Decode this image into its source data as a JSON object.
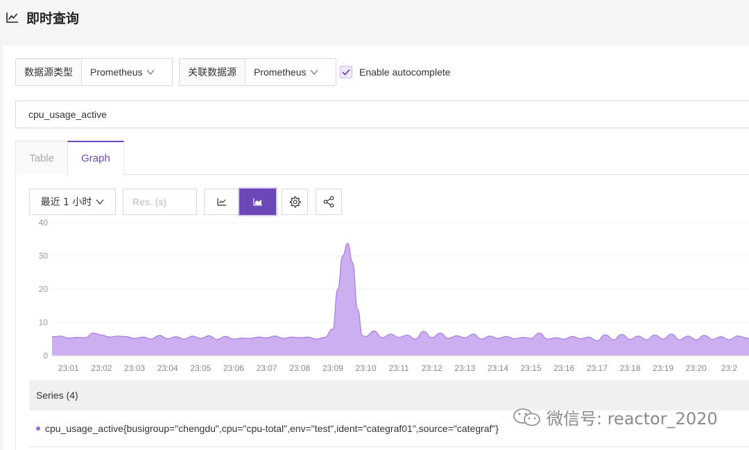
{
  "header": {
    "title": "即时查询",
    "icon": "line-chart-icon"
  },
  "toolbar": {
    "datasource_type_label": "数据源类型",
    "datasource_type_value": "Prometheus",
    "linked_datasource_label": "关联数据源",
    "linked_datasource_value": "Prometheus",
    "autocomplete_label": "Enable autocomplete",
    "autocomplete_checked": true
  },
  "query": {
    "value": "cpu_usage_active"
  },
  "tabs": [
    {
      "label": "Table",
      "active": false
    },
    {
      "label": "Graph",
      "active": true
    }
  ],
  "graph_controls": {
    "time_range": "最近 1 小时",
    "resolution_placeholder": "Res. (s)",
    "line_icon": "line-chart-icon",
    "area_icon": "area-chart-icon",
    "settings_icon": "gear-icon",
    "share_icon": "share-icon"
  },
  "chart_data": {
    "type": "area",
    "x": [
      "23:01",
      "23:02",
      "23:03",
      "23:04",
      "23:05",
      "23:06",
      "23:07",
      "23:08",
      "23:09",
      "23:10",
      "23:11",
      "23:12",
      "23:13",
      "23:14",
      "23:15",
      "23:16",
      "23:17",
      "23:18",
      "23:19",
      "23:20",
      "23:2"
    ],
    "ylim": [
      0,
      40
    ],
    "yticks": [
      0,
      10,
      20,
      30,
      40
    ],
    "x_start_minutes": 0.5,
    "x_end_minutes": 21.6,
    "series": [
      {
        "color": "#c7a6f0",
        "stroke": "#a47be0",
        "points": [
          [
            0.5,
            5.7
          ],
          [
            0.75,
            5.9
          ],
          [
            1.0,
            5.3
          ],
          [
            1.25,
            5.5
          ],
          [
            1.5,
            5.4
          ],
          [
            1.75,
            6.8
          ],
          [
            2.0,
            6.2
          ],
          [
            2.25,
            5.6
          ],
          [
            2.5,
            5.9
          ],
          [
            2.75,
            5.7
          ],
          [
            3.0,
            5.2
          ],
          [
            3.25,
            5.6
          ],
          [
            3.5,
            5.0
          ],
          [
            3.75,
            6.1
          ],
          [
            4.0,
            5.1
          ],
          [
            4.25,
            5.7
          ],
          [
            4.5,
            5.0
          ],
          [
            4.75,
            5.9
          ],
          [
            5.0,
            5.2
          ],
          [
            5.25,
            6.0
          ],
          [
            5.5,
            4.9
          ],
          [
            5.75,
            5.8
          ],
          [
            6.0,
            5.0
          ],
          [
            6.25,
            5.3
          ],
          [
            6.5,
            5.2
          ],
          [
            6.75,
            5.6
          ],
          [
            7.0,
            5.4
          ],
          [
            7.25,
            5.9
          ],
          [
            7.5,
            5.2
          ],
          [
            7.75,
            5.6
          ],
          [
            8.0,
            5.4
          ],
          [
            8.25,
            5.6
          ],
          [
            8.5,
            5.0
          ],
          [
            8.75,
            5.5
          ],
          [
            9.0,
            8.0
          ],
          [
            9.15,
            20.0
          ],
          [
            9.3,
            30.0
          ],
          [
            9.45,
            33.8
          ],
          [
            9.6,
            28.0
          ],
          [
            9.75,
            14.0
          ],
          [
            9.9,
            6.0
          ],
          [
            10.0,
            5.8
          ],
          [
            10.25,
            7.4
          ],
          [
            10.5,
            5.4
          ],
          [
            10.75,
            6.5
          ],
          [
            11.0,
            5.5
          ],
          [
            11.25,
            6.2
          ],
          [
            11.5,
            5.0
          ],
          [
            11.75,
            7.3
          ],
          [
            12.0,
            5.4
          ],
          [
            12.25,
            6.8
          ],
          [
            12.5,
            5.2
          ],
          [
            12.75,
            6.0
          ],
          [
            13.0,
            5.4
          ],
          [
            13.25,
            6.5
          ],
          [
            13.5,
            5.0
          ],
          [
            13.75,
            5.9
          ],
          [
            14.0,
            5.2
          ],
          [
            14.25,
            5.8
          ],
          [
            14.5,
            5.1
          ],
          [
            14.75,
            5.5
          ],
          [
            15.0,
            5.2
          ],
          [
            15.25,
            6.8
          ],
          [
            15.5,
            5.0
          ],
          [
            15.75,
            5.4
          ],
          [
            16.0,
            5.0
          ],
          [
            16.25,
            5.8
          ],
          [
            16.5,
            5.1
          ],
          [
            16.75,
            5.6
          ],
          [
            17.0,
            4.5
          ],
          [
            17.25,
            6.3
          ],
          [
            17.5,
            4.8
          ],
          [
            17.75,
            6.4
          ],
          [
            18.0,
            4.9
          ],
          [
            18.25,
            5.9
          ],
          [
            18.5,
            4.8
          ],
          [
            18.75,
            6.2
          ],
          [
            19.0,
            5.0
          ],
          [
            19.25,
            6.5
          ],
          [
            19.5,
            4.8
          ],
          [
            19.75,
            5.9
          ],
          [
            20.0,
            4.8
          ],
          [
            20.25,
            6.1
          ],
          [
            20.5,
            4.9
          ],
          [
            20.75,
            5.7
          ],
          [
            21.0,
            4.8
          ],
          [
            21.25,
            5.9
          ],
          [
            21.6,
            5.2
          ]
        ]
      }
    ],
    "grid": true
  },
  "series_panel": {
    "header": "Series (4)",
    "items": [
      {
        "label": "cpu_usage_active{busigroup=\"chengdu\",cpu=\"cpu-total\",env=\"test\",ident=\"categraf01\",source=\"categraf\"}",
        "color": "#9b6bdc"
      }
    ]
  },
  "watermark": {
    "text": "微信号: reactor_2020",
    "icon": "wechat-icon"
  },
  "colors": {
    "accent": "#6c47b8",
    "area_fill": "#c7a6f0"
  }
}
